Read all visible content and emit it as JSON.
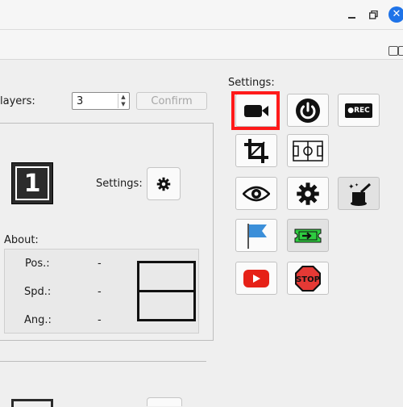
{
  "window": {
    "minimize_glyph": "minimize-icon",
    "maximize_glyph": "maximize-icon",
    "close_label": "✕"
  },
  "players": {
    "label": "layers:",
    "value": "3",
    "confirm_label": "Confirm"
  },
  "player_card": {
    "number": "1",
    "settings_label": "Settings:"
  },
  "about": {
    "title": "About:",
    "rows": [
      {
        "label": "Pos.:",
        "value": "-"
      },
      {
        "label": "Spd.:",
        "value": "-"
      },
      {
        "label": "Ang.:",
        "value": "-"
      }
    ]
  },
  "settings_panel": {
    "title": "Settings:",
    "rec_label": "●REC",
    "stop_label": "STOP",
    "buttons": [
      "camera-icon",
      "power-icon",
      "rec-icon",
      "crop-icon",
      "field-icon",
      "eye-icon",
      "gear-icon",
      "magic-wand-icon",
      "flag-icon",
      "ticket-arrow-icon",
      "youtube-icon",
      "stop-sign-icon"
    ]
  },
  "colors": {
    "selection": "#ff1a1a",
    "close": "#1e73e8",
    "flag": "#3b8fd9",
    "ticket": "#2ecc40",
    "youtube": "#e62117",
    "stop": "#e53935"
  }
}
